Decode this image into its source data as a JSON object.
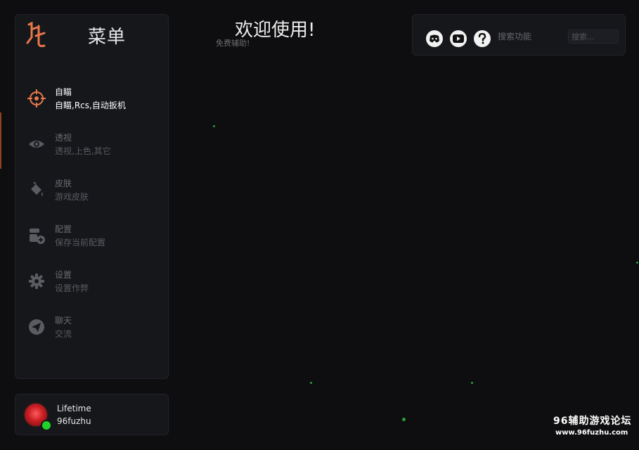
{
  "sidebar": {
    "title": "菜单",
    "items": [
      {
        "title": "自瞄",
        "subtitle": "自瞄,Rcs,自动扳机",
        "icon": "crosshair-icon",
        "active": true
      },
      {
        "title": "透视",
        "subtitle": "透视,上色,其它",
        "icon": "eye-icon",
        "active": false
      },
      {
        "title": "皮肤",
        "subtitle": "游戏皮肤",
        "icon": "paint-bucket-icon",
        "active": false
      },
      {
        "title": "配置",
        "subtitle": "保存当前配置",
        "icon": "config-add-icon",
        "active": false
      },
      {
        "title": "设置",
        "subtitle": "设置作弊",
        "icon": "gear-icon",
        "active": false
      },
      {
        "title": "聊天",
        "subtitle": "交流",
        "icon": "paper-plane-icon",
        "active": false
      }
    ]
  },
  "user": {
    "plan": "Lifetime",
    "name": "96fuzhu",
    "status": "online"
  },
  "main": {
    "welcome": "欢迎使用!",
    "tagline": "免费辅助!"
  },
  "topbar": {
    "search_label": "搜索功能",
    "search_placeholder": "搜索...",
    "search_value": ""
  },
  "watermark": {
    "title": "96辅助游戏论坛",
    "url": "www.96fuzhu.com"
  },
  "colors": {
    "accent": "#e8784a",
    "background": "#0e0e10",
    "panel": "#16171b",
    "online": "#1fd32a",
    "particle": "#2e9b3a"
  }
}
